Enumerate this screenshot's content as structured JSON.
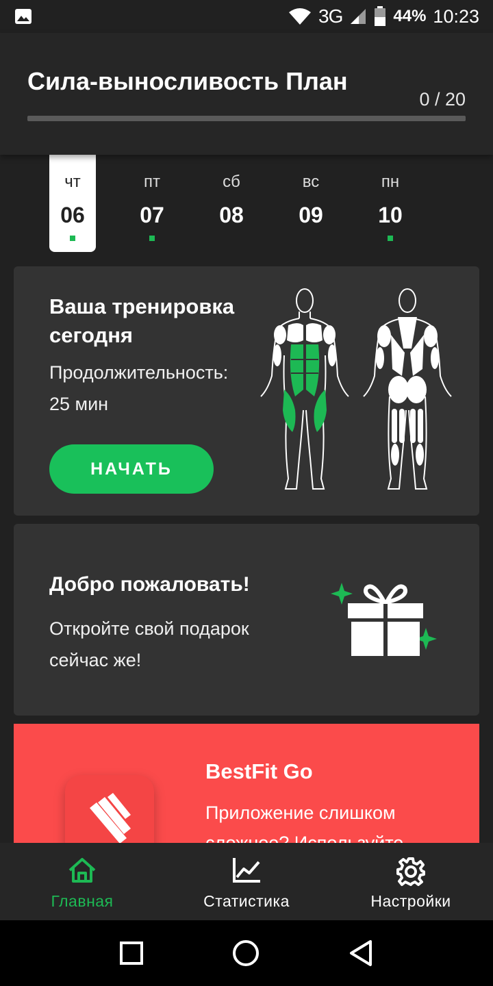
{
  "status_bar": {
    "network": "3G",
    "battery": "44%",
    "time": "10:23"
  },
  "header": {
    "title": "Сила-выносливость План",
    "progress_text": "0 / 20",
    "progress_fraction": 0
  },
  "days": [
    {
      "name": "чт",
      "num": "06",
      "dot": true,
      "active": true
    },
    {
      "name": "пт",
      "num": "07",
      "dot": true,
      "active": false
    },
    {
      "name": "сб",
      "num": "08",
      "dot": false,
      "active": false
    },
    {
      "name": "вс",
      "num": "09",
      "dot": false,
      "active": false
    },
    {
      "name": "пн",
      "num": "10",
      "dot": true,
      "active": false
    }
  ],
  "workout": {
    "title": "Ваша тренировка сегодня",
    "duration_label": "Продолжительность:",
    "duration_value": "25 мин",
    "start_label": "НАЧАТЬ"
  },
  "welcome": {
    "title": "Добро пожаловать!",
    "text": "Откройте свой подарок сейчас же!"
  },
  "promo": {
    "title": "BestFit Go",
    "text": "Приложение слишком сложное? Используйте"
  },
  "nav": {
    "home": "Главная",
    "stats": "Статистика",
    "settings": "Настройки"
  },
  "colors": {
    "accent": "#1db954",
    "promo": "#fb4b4b",
    "card": "#333333",
    "background": "#212121"
  }
}
